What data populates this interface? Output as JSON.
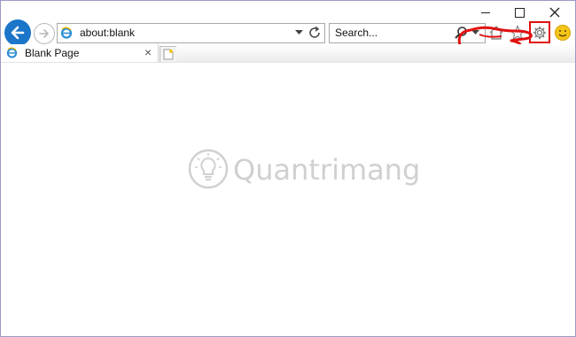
{
  "window": {
    "caption_buttons": [
      "minimize",
      "maximize",
      "close"
    ]
  },
  "navigation": {
    "back_icon": "back-arrow-icon",
    "forward_icon": "forward-arrow-icon"
  },
  "address_bar": {
    "value": "about:blank",
    "icons": [
      "ie-logo-icon",
      "dropdown-arrow-icon",
      "refresh-icon"
    ]
  },
  "search_bar": {
    "placeholder": "Search...",
    "icons": [
      "search-icon",
      "dropdown-arrow-icon"
    ]
  },
  "toolbar": {
    "icons": [
      "home-icon",
      "favorites-star-icon",
      "gear-icon",
      "smiley-feedback-icon"
    ],
    "highlight_color": "#e01010"
  },
  "tabs": [
    {
      "label": "Blank Page",
      "icon": "ie-logo-icon",
      "close": "×"
    }
  ],
  "new_tab_icon": "new-tab-icon",
  "watermark": {
    "text": "Quantrimang",
    "icon": "lightbulb-icon"
  },
  "colors": {
    "accent": "#1b75c9",
    "frame_border": "#9a9ac6",
    "annotation": "#e01010"
  }
}
